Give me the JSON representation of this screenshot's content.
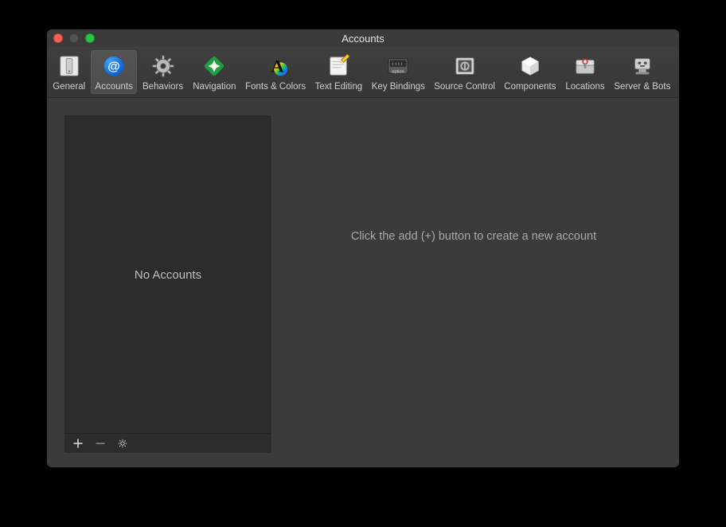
{
  "window": {
    "title": "Accounts"
  },
  "toolbar": {
    "selected_index": 1,
    "items": [
      {
        "label": "General"
      },
      {
        "label": "Accounts"
      },
      {
        "label": "Behaviors"
      },
      {
        "label": "Navigation"
      },
      {
        "label": "Fonts & Colors"
      },
      {
        "label": "Text Editing"
      },
      {
        "label": "Key Bindings"
      },
      {
        "label": "Source Control"
      },
      {
        "label": "Components"
      },
      {
        "label": "Locations"
      },
      {
        "label": "Server & Bots"
      }
    ]
  },
  "sidebar": {
    "empty_text": "No Accounts"
  },
  "detail": {
    "hint": "Click the add (+) button to create a new account"
  }
}
